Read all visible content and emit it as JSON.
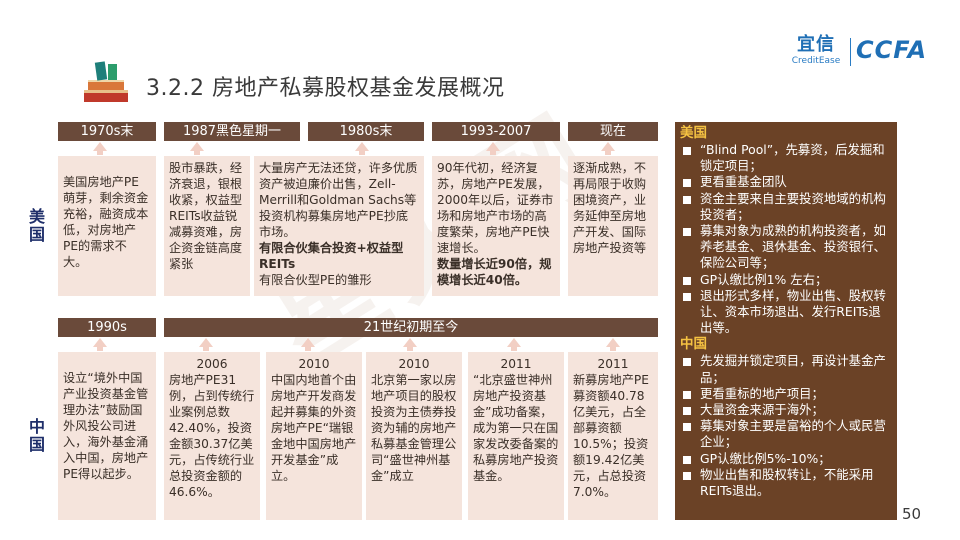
{
  "header": {
    "title": "3.2.2 房地产私募股权基金发展概况",
    "logo_cn": "宜信",
    "logo_en": "CreditEase",
    "logo_ccfa": "CCFA"
  },
  "watermark": "星火网",
  "countries": {
    "us": "美国",
    "cn": "中国"
  },
  "us": {
    "periods": [
      "1970s末",
      "1987黑色星期一",
      "1980s末",
      "1993-2007",
      "现在"
    ],
    "boxes": [
      {
        "text": "美国房地产PE萌芽，剩余资金充裕，融资成本低，对房地产PE的需求不大。",
        "bold": "",
        "tail": ""
      },
      {
        "text": "股市暴跌，经济衰退，银根收紧，权益型REITs收益锐减募资难，房企资金链高度紧张",
        "bold": "",
        "tail": ""
      },
      {
        "text": "大量房产无法还贷，许多优质资产被迫廉价出售，Zell-Merrill和Goldman Sachs等投资机构募集房地产PE抄底市场。",
        "bold": "有限合伙集合投资+权益型 REITs",
        "tail": "有限合伙型PE的雏形"
      },
      {
        "text": "90年代初，经济复苏，房地产PE发展，2000年以后，证券市场和房地产市场的高度繁荣，房地产PE快速增长。",
        "bold": "数量增长近90倍，规模增长近40倍。",
        "tail": ""
      },
      {
        "text": "逐渐成熟，不再局限于收购困境资产，业务延伸至房地产开发、国际房地产投资等",
        "bold": "",
        "tail": ""
      }
    ]
  },
  "cn": {
    "periods": [
      "1990s",
      "21世纪初期至今"
    ],
    "boxes": [
      {
        "year": "",
        "text": "设立“境外中国产业投资基金管理办法”鼓励国外风投公司进入，海外基金涌入中国，房地产PE得以起步。"
      },
      {
        "year": "2006",
        "text": "房地产PE31例，占到传统行业案例总数42.40%，投资金额30.37亿美元，占传统行业总投资金额的46.6%。"
      },
      {
        "year": "2010",
        "text": "中国内地首个由房地产开发商发起并募集的外资房地产PE“瑞银金地中国房地产开发基金”成立。"
      },
      {
        "year": "2010",
        "text": "北京第一家以房地产项目的股权投资为主债券投资为辅的房地产私募基金管理公司“盛世神州基金”成立"
      },
      {
        "year": "2011",
        "text": "“北京盛世神州房地产投资基金”成功备案，成为第一只在国家发改委备案的私募房地产投资基金。"
      },
      {
        "year": "2011",
        "text": "新募房地产PE募资额40.78亿美元，占全部募资额10.5%；投资额19.42亿美元，占总投资7.0%。"
      }
    ]
  },
  "panel": {
    "us_heading": "美国",
    "us_items": [
      "“Blind Pool”，先募资，后发掘和锁定项目；",
      "更看重基金团队",
      "资金主要来自主要投资地域的机构投资者；",
      "募集对象为成熟的机构投资者，如养老基金、退休基金、投资银行、保险公司等；",
      "GP认缴比例1% 左右；",
      "退出形式多样，物业出售、股权转让、资本市场退出、发行REITs退出等。"
    ],
    "cn_heading": "中国",
    "cn_items": [
      "先发掘并锁定项目，再设计基金产品；",
      "更看重标的地产项目；",
      "大量资金来源于海外；",
      "募集对象主要是富裕的个人或民营企业；",
      "GP认缴比例5%-10%；",
      "物业出售和股权转让，不能采用REITs退出。"
    ]
  },
  "page_number": "50",
  "colors": {
    "bar": "#6a4a3a",
    "box": "#f5e4dc",
    "arrow": "#f2cfc4",
    "panel": "#6b4226",
    "panel_heading": "#f5c242",
    "country_label": "#1f2f6a",
    "logo_blue": "#1f6fb5"
  },
  "icons": [
    "books-icon",
    "bullet-square-icon",
    "arrow-up-icon"
  ]
}
